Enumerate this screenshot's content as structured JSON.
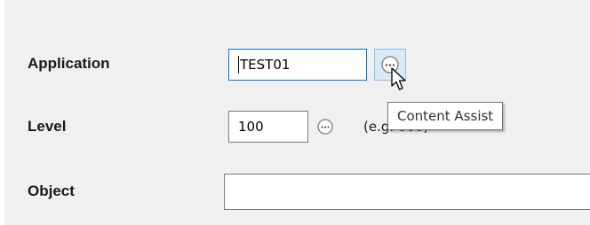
{
  "form": {
    "application": {
      "label": "Application",
      "value": "TEST01"
    },
    "level": {
      "label": "Level",
      "value": "100",
      "hint": "(e.g. 000)"
    },
    "object": {
      "label": "Object",
      "value": ""
    }
  },
  "tooltip": {
    "text": "Content Assist"
  },
  "icons": {
    "assist": "ellipsis-circle-icon",
    "cursor": "mouse-pointer-icon"
  },
  "colors": {
    "panel_background": "#f0f0f0",
    "focus_border": "#0078d7",
    "hover_button_background": "#d9eaf7"
  }
}
